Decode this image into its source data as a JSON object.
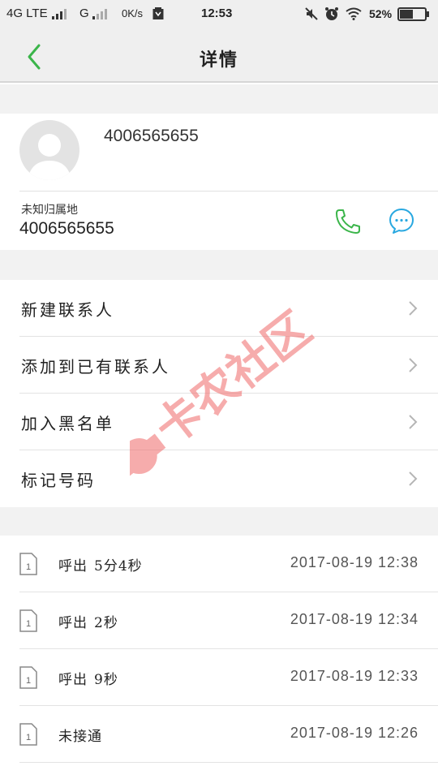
{
  "status_bar": {
    "network": "4G LTE",
    "network2": "G",
    "speed": "0K/s",
    "time": "12:53",
    "battery": "52%"
  },
  "header": {
    "title": "详情"
  },
  "contact": {
    "name": "4006565655",
    "location": "未知归属地",
    "number": "4006565655"
  },
  "menu": [
    {
      "label": "新建联系人"
    },
    {
      "label": "添加到已有联系人"
    },
    {
      "label": "加入黑名单"
    },
    {
      "label": "标记号码"
    }
  ],
  "call_log": [
    {
      "type": "呼出",
      "duration": "5分4秒",
      "time": "2017-08-19  12:38"
    },
    {
      "type": "呼出",
      "duration": "2秒",
      "time": "2017-08-19  12:34"
    },
    {
      "type": "呼出",
      "duration": "9秒",
      "time": "2017-08-19  12:33"
    },
    {
      "type": "未接通",
      "duration": "",
      "time": "2017-08-19  12:26"
    }
  ],
  "watermark": {
    "text": "卡农社区"
  },
  "colors": {
    "accent_green": "#3bb54a",
    "message_blue": "#29a8e0",
    "watermark_red": "#f06a6a"
  },
  "icons": [
    "back-arrow-icon",
    "phone-icon",
    "message-icon",
    "chevron-right-icon",
    "sim-card-icon"
  ]
}
